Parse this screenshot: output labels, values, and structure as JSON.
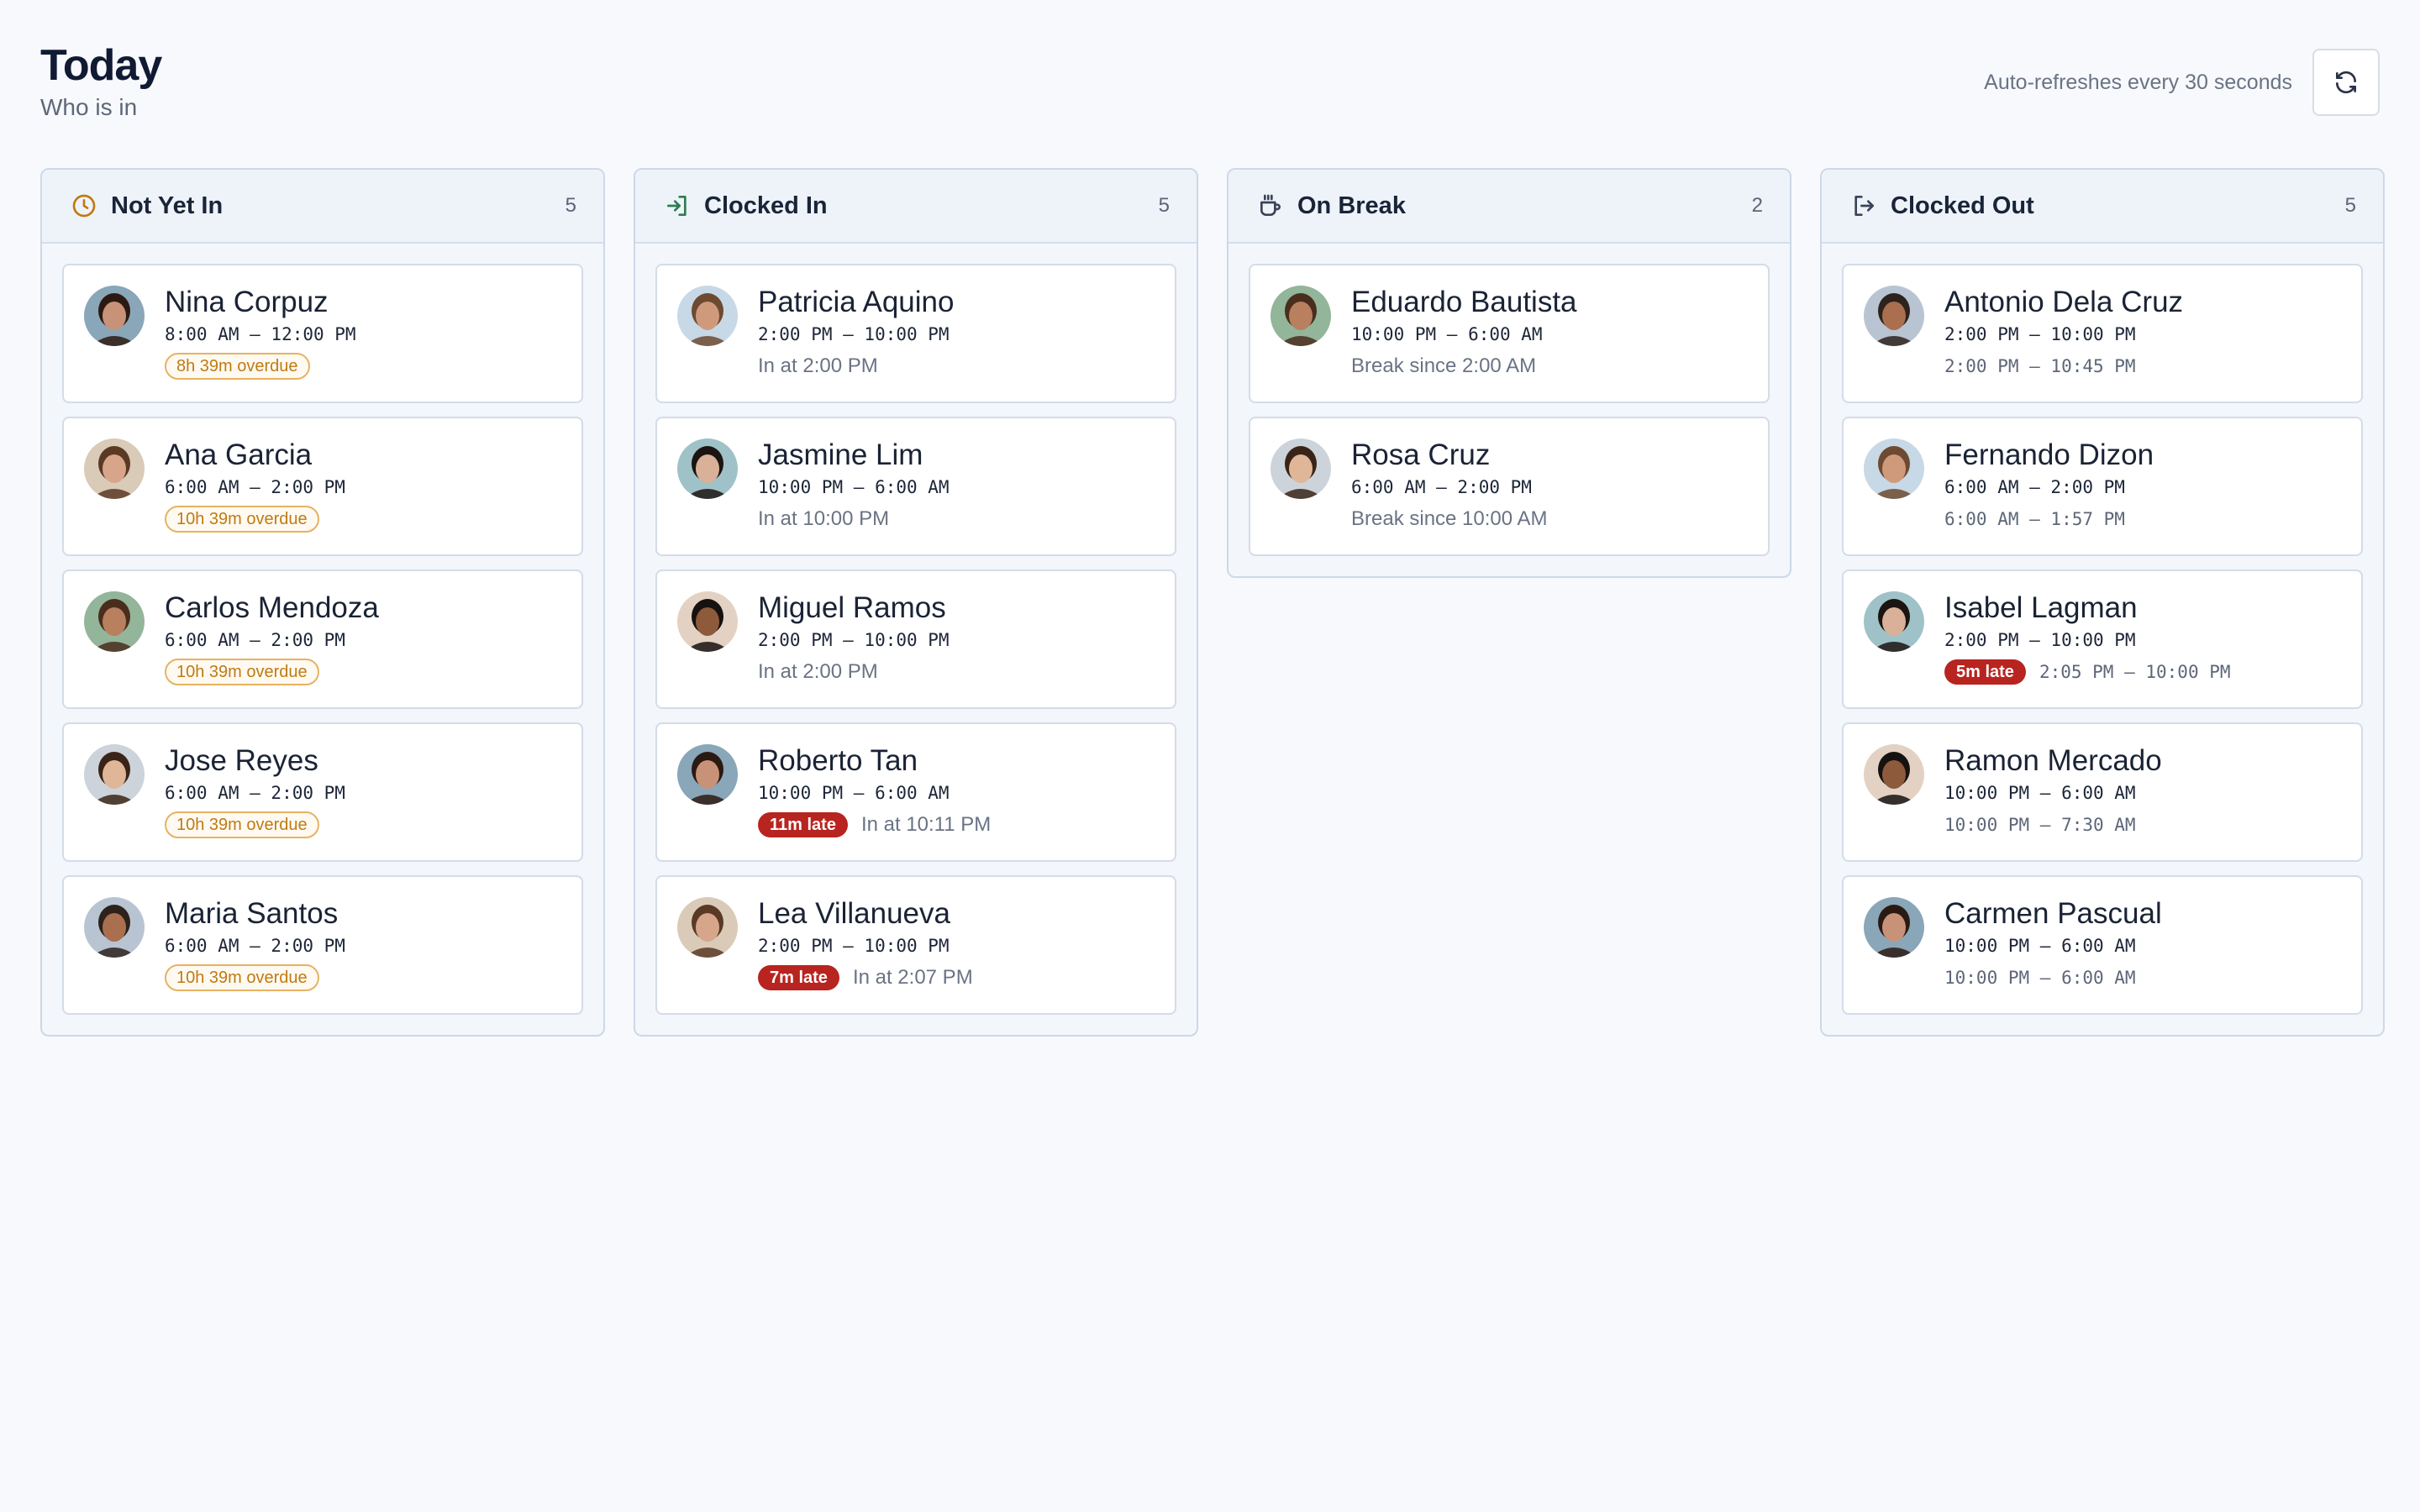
{
  "header": {
    "title": "Today",
    "subtitle": "Who is in",
    "auto_refresh": "Auto-refreshes every 30 seconds",
    "refresh_icon": "refresh-icon"
  },
  "colors": {
    "amber": "#c07a12",
    "green": "#2e7d4f",
    "late_red": "#b8241f",
    "border": "#cdd8e8"
  },
  "columns": [
    {
      "title": "Not Yet In",
      "count": "5",
      "icon": "clock-icon",
      "cards": [
        {
          "name": "Nina Corpuz",
          "shift": "8:00 AM – 12:00 PM",
          "badge": "8h 39m overdue"
        },
        {
          "name": "Ana Garcia",
          "shift": "6:00 AM – 2:00 PM",
          "badge": "10h 39m overdue"
        },
        {
          "name": "Carlos Mendoza",
          "shift": "6:00 AM – 2:00 PM",
          "badge": "10h 39m overdue"
        },
        {
          "name": "Jose Reyes",
          "shift": "6:00 AM – 2:00 PM",
          "badge": "10h 39m overdue"
        },
        {
          "name": "Maria Santos",
          "shift": "6:00 AM – 2:00 PM",
          "badge": "10h 39m overdue"
        }
      ]
    },
    {
      "title": "Clocked In",
      "count": "5",
      "icon": "login-icon",
      "cards": [
        {
          "name": "Patricia Aquino",
          "shift": "2:00 PM – 10:00 PM",
          "note": "In at 2:00 PM"
        },
        {
          "name": "Jasmine Lim",
          "shift": "10:00 PM – 6:00 AM",
          "note": "In at 10:00 PM"
        },
        {
          "name": "Miguel Ramos",
          "shift": "2:00 PM – 10:00 PM",
          "note": "In at 2:00 PM"
        },
        {
          "name": "Roberto Tan",
          "shift": "10:00 PM – 6:00 AM",
          "late": "11m late",
          "note": "In at 10:11 PM"
        },
        {
          "name": "Lea Villanueva",
          "shift": "2:00 PM – 10:00 PM",
          "late": "7m late",
          "note": "In at 2:07 PM"
        }
      ]
    },
    {
      "title": "On Break",
      "count": "2",
      "icon": "coffee-icon",
      "cards": [
        {
          "name": "Eduardo Bautista",
          "shift": "10:00 PM – 6:00 AM",
          "note": "Break since 2:00 AM"
        },
        {
          "name": "Rosa Cruz",
          "shift": "6:00 AM – 2:00 PM",
          "note": "Break since 10:00 AM"
        }
      ]
    },
    {
      "title": "Clocked Out",
      "count": "5",
      "icon": "logout-icon",
      "cards": [
        {
          "name": "Antonio Dela Cruz",
          "shift": "2:00 PM – 10:00 PM",
          "actual": "2:00 PM – 10:45 PM"
        },
        {
          "name": "Fernando Dizon",
          "shift": "6:00 AM – 2:00 PM",
          "actual": "6:00 AM – 1:57 PM"
        },
        {
          "name": "Isabel Lagman",
          "shift": "2:00 PM – 10:00 PM",
          "late": "5m late",
          "actual": "2:05 PM – 10:00 PM"
        },
        {
          "name": "Ramon Mercado",
          "shift": "10:00 PM – 6:00 AM",
          "actual": "10:00 PM – 7:30 AM"
        },
        {
          "name": "Carmen Pascual",
          "shift": "10:00 PM – 6:00 AM",
          "actual": "10:00 PM – 6:00 AM"
        }
      ]
    }
  ]
}
